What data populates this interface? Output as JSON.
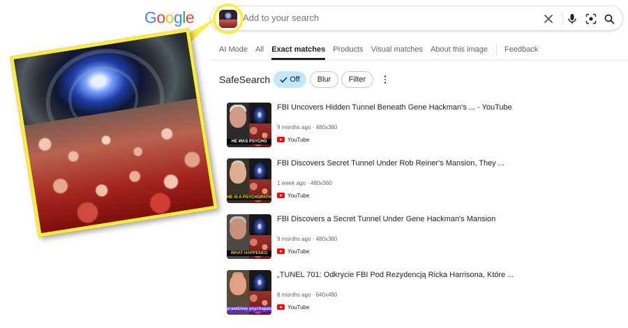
{
  "logo": {
    "letters": [
      "G",
      "o",
      "o",
      "g",
      "l",
      "e"
    ],
    "colors": [
      "#4285F4",
      "#EA4335",
      "#FBBC05",
      "#4285F4",
      "#34A853",
      "#EA4335"
    ]
  },
  "search": {
    "placeholder": "Add to your search",
    "icons": [
      "clear-icon",
      "microphone-icon",
      "lens-icon",
      "search-icon"
    ]
  },
  "tabs": [
    {
      "label": "AI Mode",
      "active": false
    },
    {
      "label": "All",
      "active": false
    },
    {
      "label": "Exact matches",
      "active": true
    },
    {
      "label": "Products",
      "active": false
    },
    {
      "label": "Visual matches",
      "active": false
    },
    {
      "label": "About this image",
      "active": false
    },
    {
      "label": "Feedback",
      "active": false
    }
  ],
  "safesearch": {
    "label": "SafeSearch",
    "options": [
      {
        "label": "Off",
        "selected": true
      },
      {
        "label": "Blur",
        "selected": false
      },
      {
        "label": "Filter",
        "selected": false
      }
    ]
  },
  "results": [
    {
      "title": "FBI Uncovers Hidden Tunnel Beneath Gene Hackman's ... - YouTube",
      "age": "9 months ago",
      "size": "480x360",
      "source": "YouTube",
      "thumb_caption": "HE WAS PSYCHO"
    },
    {
      "title": "FBI Discovers Secret Tunnel Under Rob Reiner's Mansion, They ...",
      "age": "1 week ago",
      "size": "480x360",
      "source": "YouTube",
      "thumb_caption": "HE IS A PSYCHOPATH"
    },
    {
      "title": "FBI Discovers a Secret Tunnel Under Gene Hackman's Mansion",
      "age": "9 months ago",
      "size": "480x360",
      "source": "YouTube",
      "thumb_caption": "WHAT HAPPENED"
    },
    {
      "title": "„TUNEL 701: Odkrycie FBI Pod Rezydencją Ricka Harrisona, Które ...",
      "age": "8 months ago",
      "size": "640x480",
      "source": "YouTube",
      "thumb_caption": "prawdziwy psychopata"
    }
  ],
  "colors": {
    "highlight_yellow": "#fcec3e",
    "chip_selected": "#c2e7ff",
    "youtube_red": "#ff0000"
  }
}
